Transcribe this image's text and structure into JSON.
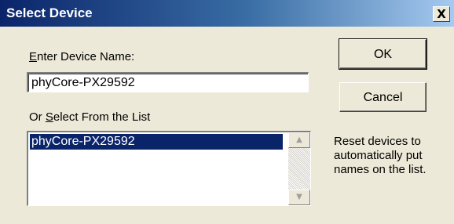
{
  "window": {
    "title": "Select Device",
    "close_glyph": "X"
  },
  "device_name": {
    "label_accel": "E",
    "label_rest": "nter Device Name:",
    "value": "phyCore-PX29592"
  },
  "device_list": {
    "label_pre": "Or ",
    "label_accel": "S",
    "label_rest": "elect From the List",
    "items": [
      "phyCore-PX29592"
    ],
    "selected_index": 0
  },
  "buttons": {
    "ok": "OK",
    "cancel": "Cancel"
  },
  "hint": {
    "lines": [
      "Reset devices to",
      "automatically put",
      "names on the list."
    ]
  },
  "icons": {
    "scroll_up": "up-arrow-icon",
    "scroll_down": "down-arrow-icon"
  },
  "colors": {
    "titlebar_start": "#0a246a",
    "titlebar_end": "#a6caf0",
    "selection": "#0a246a",
    "dialog_face": "#ece9d8"
  }
}
